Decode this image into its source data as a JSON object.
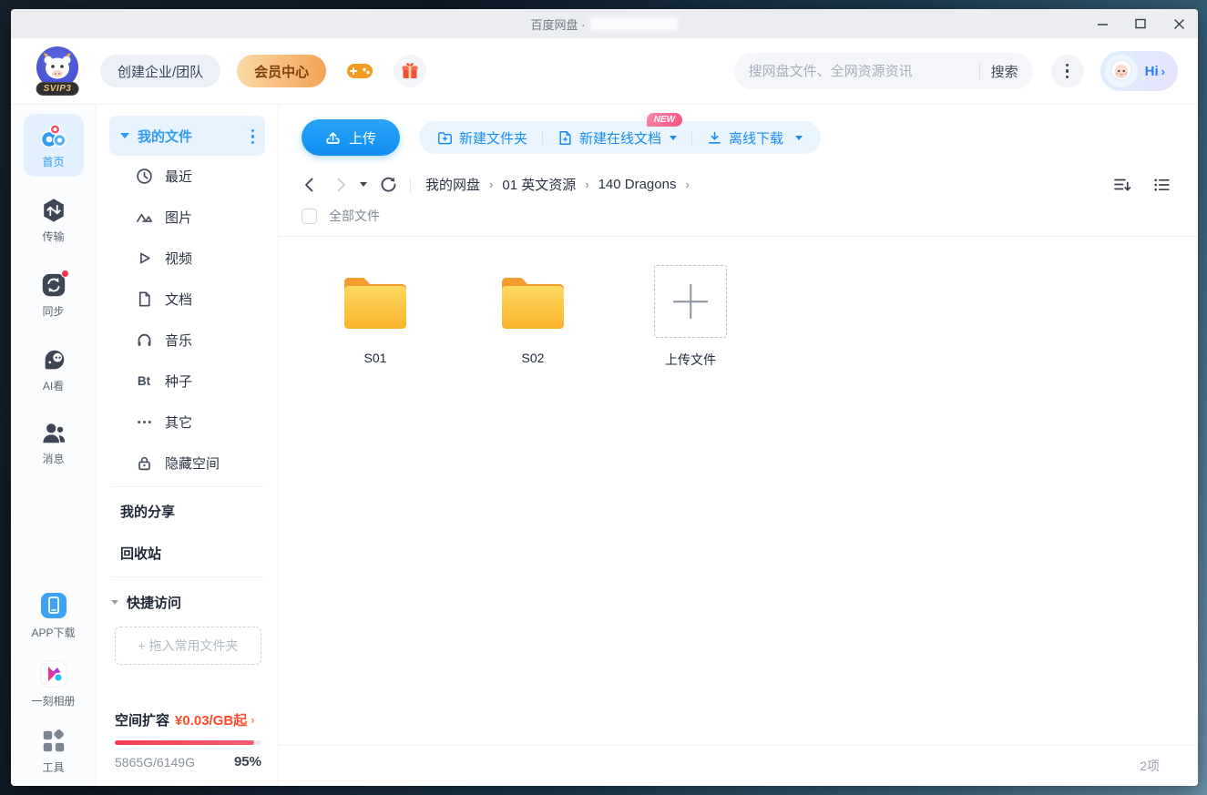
{
  "window": {
    "title": "百度网盘 ·",
    "controls": {
      "minimize": "最小化",
      "maximize": "最大化",
      "close": "关闭"
    }
  },
  "header": {
    "svip_badge": "SVIP3",
    "create_team": "创建企业/团队",
    "member_center": "会员中心",
    "search": {
      "placeholder": "搜网盘文件、全网资源资讯",
      "button": "搜索"
    },
    "greeting": "Hi",
    "greeting_chevron": "›"
  },
  "rail": {
    "items": [
      {
        "label": "首页",
        "active": true
      },
      {
        "label": "传输"
      },
      {
        "label": "同步"
      },
      {
        "label": "AI看"
      },
      {
        "label": "消息"
      }
    ],
    "bottom_items": [
      {
        "label": "APP下载"
      },
      {
        "label": "一刻相册"
      },
      {
        "label": "工具"
      }
    ]
  },
  "sidebar": {
    "my_files": "我的文件",
    "items": [
      {
        "label": "最近"
      },
      {
        "label": "图片"
      },
      {
        "label": "视频"
      },
      {
        "label": "文档"
      },
      {
        "label": "音乐"
      },
      {
        "label": "种子",
        "icon_text": "Bt"
      },
      {
        "label": "其它"
      },
      {
        "label": "隐藏空间"
      }
    ],
    "links": [
      "我的分享",
      "回收站"
    ],
    "quick_access": "快捷访问",
    "drop_hint": "+ 拖入常用文件夹",
    "storage": {
      "title": "空间扩容",
      "price": "¥0.03/GB起",
      "chevron": "›",
      "usage": "5865G/6149G",
      "percent": "95%",
      "percent_value": 95
    }
  },
  "toolbar": {
    "upload": "上传",
    "new_folder": "新建文件夹",
    "new_doc": "新建在线文档",
    "new_badge": "NEW",
    "offline_download": "离线下载"
  },
  "nav": {
    "breadcrumbs": [
      "我的网盘",
      "01 英文资源",
      "140 Dragons"
    ],
    "separator": "›"
  },
  "content": {
    "select_all": "全部文件",
    "folders": [
      {
        "name": "S01"
      },
      {
        "name": "S02"
      }
    ],
    "upload_tile": "上传文件",
    "item_count": "2项"
  },
  "colors": {
    "accent_blue": "#1b8df2",
    "member_gradient": "#f3a355",
    "badge_pink": "#f7537f",
    "storage_red": "#ff4b2e",
    "folder_yellow": "#fbbc2e"
  }
}
